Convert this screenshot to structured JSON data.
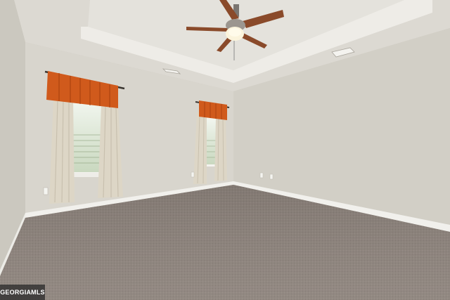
{
  "scene": {
    "description_id": "empty-room-photo",
    "watermark": {
      "text": "GEORGIAMLS"
    },
    "colors": {
      "wall": "#d7d4cc",
      "wall_shadow": "#c6c2b9",
      "ceiling": "#dedbd4",
      "tray": "#e3e0da",
      "carpet": "#8d837c",
      "baseboard": "#f1f0ec",
      "curtain_orange": "#d05a1c",
      "curtain_panel": "#ddd6c6",
      "fan_blade": "#8a4a2a"
    }
  }
}
